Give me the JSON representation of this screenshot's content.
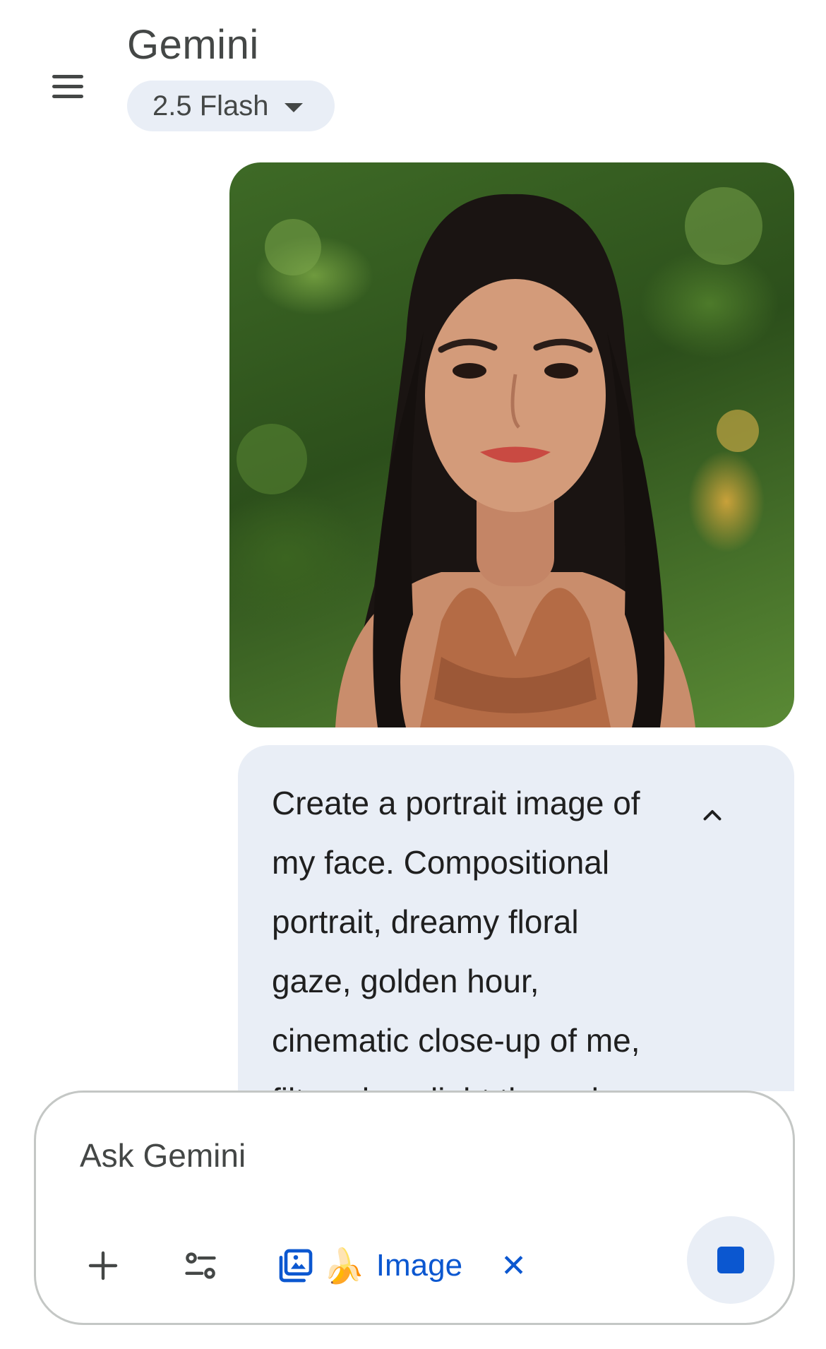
{
  "header": {
    "title": "Gemini",
    "model_label": "2.5 Flash",
    "menu_icon": "hamburger-menu-icon",
    "model_caret_icon": "caret-down-icon"
  },
  "conversation": {
    "uploaded_image": {
      "kind": "user-uploaded-photo"
    },
    "prompt": {
      "text_lines": [
        "Create a portrait image of",
        "my face. Compositional",
        "portrait, dreamy floral",
        "gaze, golden hour,",
        "cinematic close-up of me,",
        "filtered sunlight through"
      ],
      "collapse_icon": "chevron-up-icon"
    }
  },
  "composer": {
    "placeholder": "Ask Gemini",
    "add_icon": "plus-icon",
    "tools_icon": "tools-sliders-icon",
    "image_tool": {
      "icon": "image-gallery-icon",
      "emoji": "🍌",
      "label": "Image",
      "close_icon": "close-icon"
    },
    "stop_icon": "stop-icon"
  },
  "colors": {
    "accent": "#0b57d0",
    "chip_bg": "#e9eef6",
    "text": "#1f1f1f",
    "muted": "#444746"
  }
}
